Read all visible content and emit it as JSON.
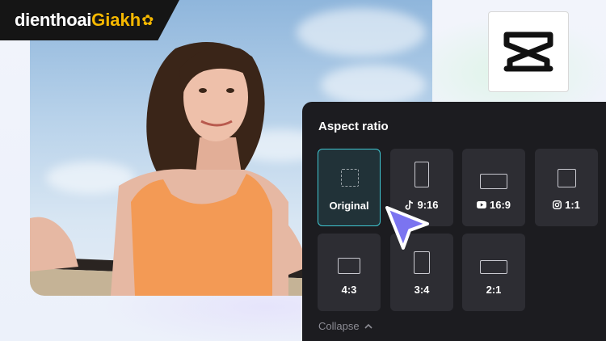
{
  "brand": {
    "name_main": "dienthoai",
    "name_accent": "Giakh",
    "flower": "✿"
  },
  "app_logo": {
    "icon": "capcut-logo-icon"
  },
  "panel": {
    "title": "Aspect ratio",
    "options": [
      {
        "label": "Original",
        "icon": "",
        "selected": true
      },
      {
        "label": "9:16",
        "icon": "tiktok-icon",
        "selected": false
      },
      {
        "label": "16:9",
        "icon": "youtube-icon",
        "selected": false
      },
      {
        "label": "1:1",
        "icon": "instagram-icon",
        "selected": false
      },
      {
        "label": "4:3",
        "icon": "",
        "selected": false
      },
      {
        "label": "3:4",
        "icon": "",
        "selected": false
      },
      {
        "label": "2:1",
        "icon": "",
        "selected": false
      }
    ],
    "collapse_label": "Collapse"
  },
  "colors": {
    "accent": "#3fc7d2",
    "cursor": "#7b74f0",
    "panel_bg": "#1c1c20",
    "brand_yellow": "#f5b800"
  }
}
